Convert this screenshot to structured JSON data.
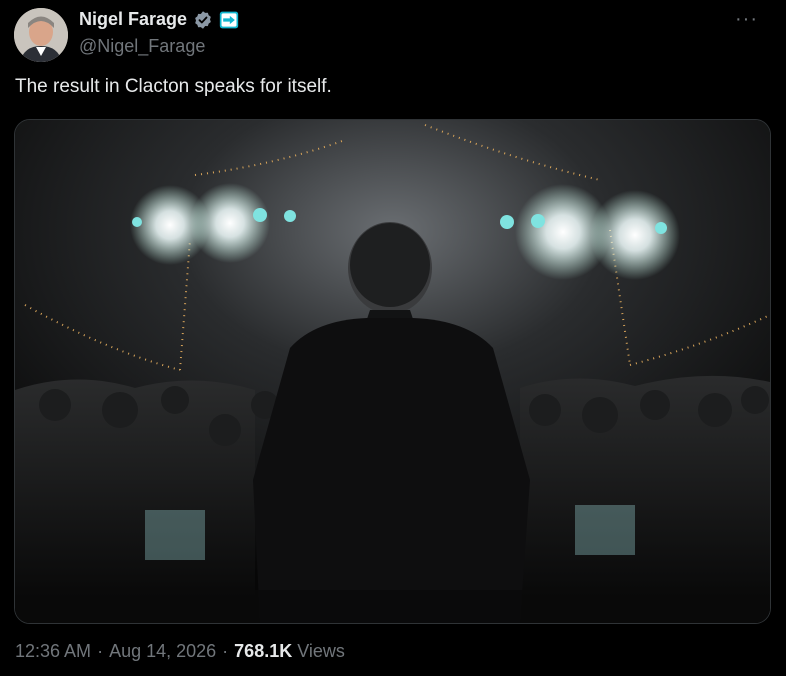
{
  "author": {
    "name": "Nigel Farage",
    "handle": "@Nigel_Farage",
    "verified": true,
    "affiliate_badge": "reform-uk-arrow-badge",
    "colors": {
      "verified": "#8b98a5",
      "affiliate_bg": "#12b6cf"
    }
  },
  "post": {
    "text": "The result in Clacton speaks for itself.",
    "media_description": "Silhouetted speaker on stage facing a large crowd under stage lights and string lights"
  },
  "meta": {
    "time": "12:36 AM",
    "separator": "·",
    "date": "Aug 14, 2026",
    "views_count": "768.1K",
    "views_label": "Views"
  },
  "menu": {
    "more_label": "···"
  }
}
